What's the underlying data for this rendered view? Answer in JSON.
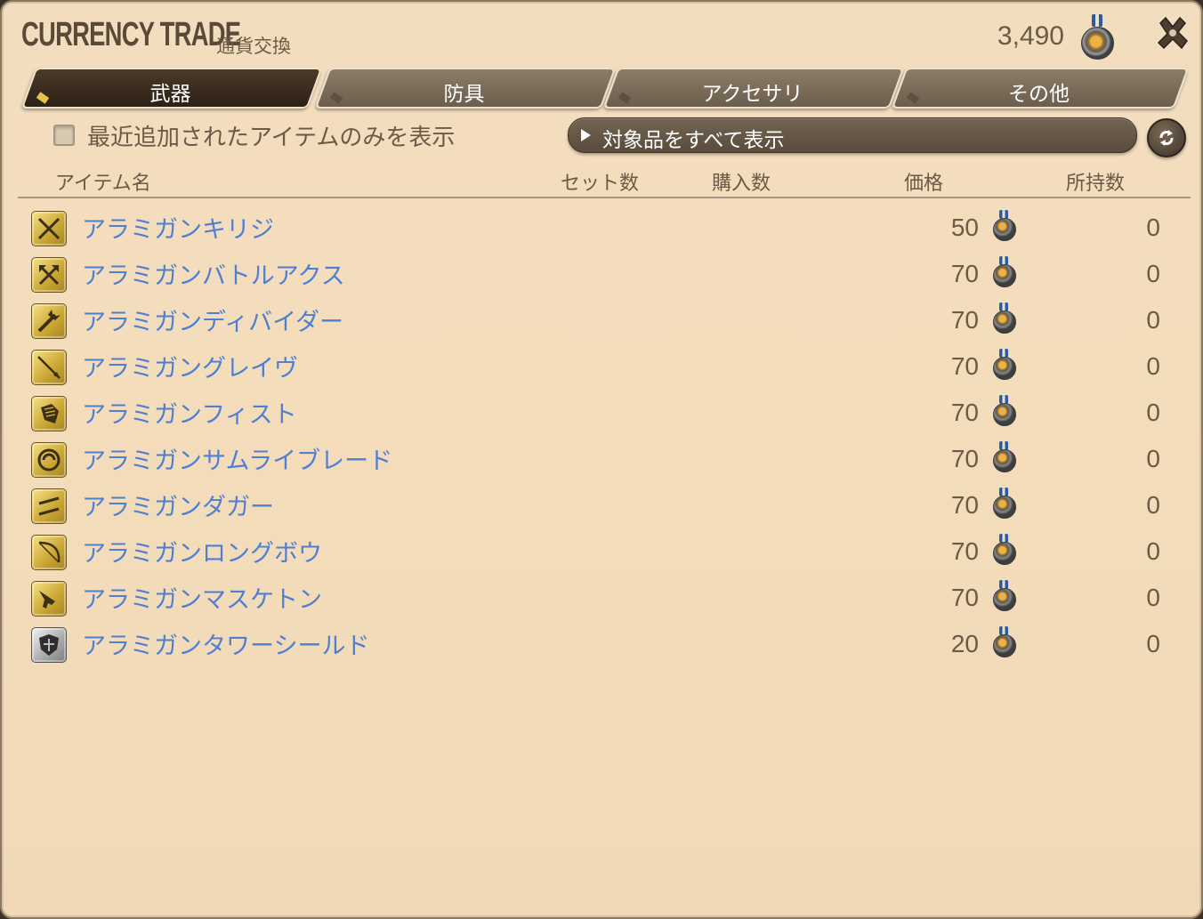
{
  "window": {
    "title_en": "CURRENCY TRADE",
    "title_jp": "通貨交換",
    "currency_amount": "3,490",
    "currency_icon": "medal-icon",
    "settings_icon": "gear-icon"
  },
  "tabs": [
    {
      "label": "武器",
      "active": true
    },
    {
      "label": "防具",
      "active": false
    },
    {
      "label": "アクセサリ",
      "active": false
    },
    {
      "label": "その他",
      "active": false
    }
  ],
  "filter": {
    "checkbox_label": "最近追加されたアイテムのみを表示",
    "checked": false,
    "dropdown_value": "対象品をすべて表示",
    "refresh_icon": "refresh-icon"
  },
  "columns": {
    "name": "アイテム名",
    "set_count": "セット数",
    "purchase_count": "購入数",
    "price": "価格",
    "owned": "所持数"
  },
  "items": [
    {
      "name": "アラミガンキリジ",
      "price": "50",
      "owned": "0",
      "icon": "sword-icon"
    },
    {
      "name": "アラミガンバトルアクス",
      "price": "70",
      "owned": "0",
      "icon": "axe-icon"
    },
    {
      "name": "アラミガンディバイダー",
      "price": "70",
      "owned": "0",
      "icon": "gunblade-icon"
    },
    {
      "name": "アラミガングレイヴ",
      "price": "70",
      "owned": "0",
      "icon": "lance-icon"
    },
    {
      "name": "アラミガンフィスト",
      "price": "70",
      "owned": "0",
      "icon": "fist-icon"
    },
    {
      "name": "アラミガンサムライブレード",
      "price": "70",
      "owned": "0",
      "icon": "katana-icon"
    },
    {
      "name": "アラミガンダガー",
      "price": "70",
      "owned": "0",
      "icon": "dagger-icon"
    },
    {
      "name": "アラミガンロングボウ",
      "price": "70",
      "owned": "0",
      "icon": "bow-icon"
    },
    {
      "name": "アラミガンマスケトン",
      "price": "70",
      "owned": "0",
      "icon": "gun-icon"
    },
    {
      "name": "アラミガンタワーシールド",
      "price": "20",
      "owned": "0",
      "icon": "shield-icon"
    }
  ]
}
